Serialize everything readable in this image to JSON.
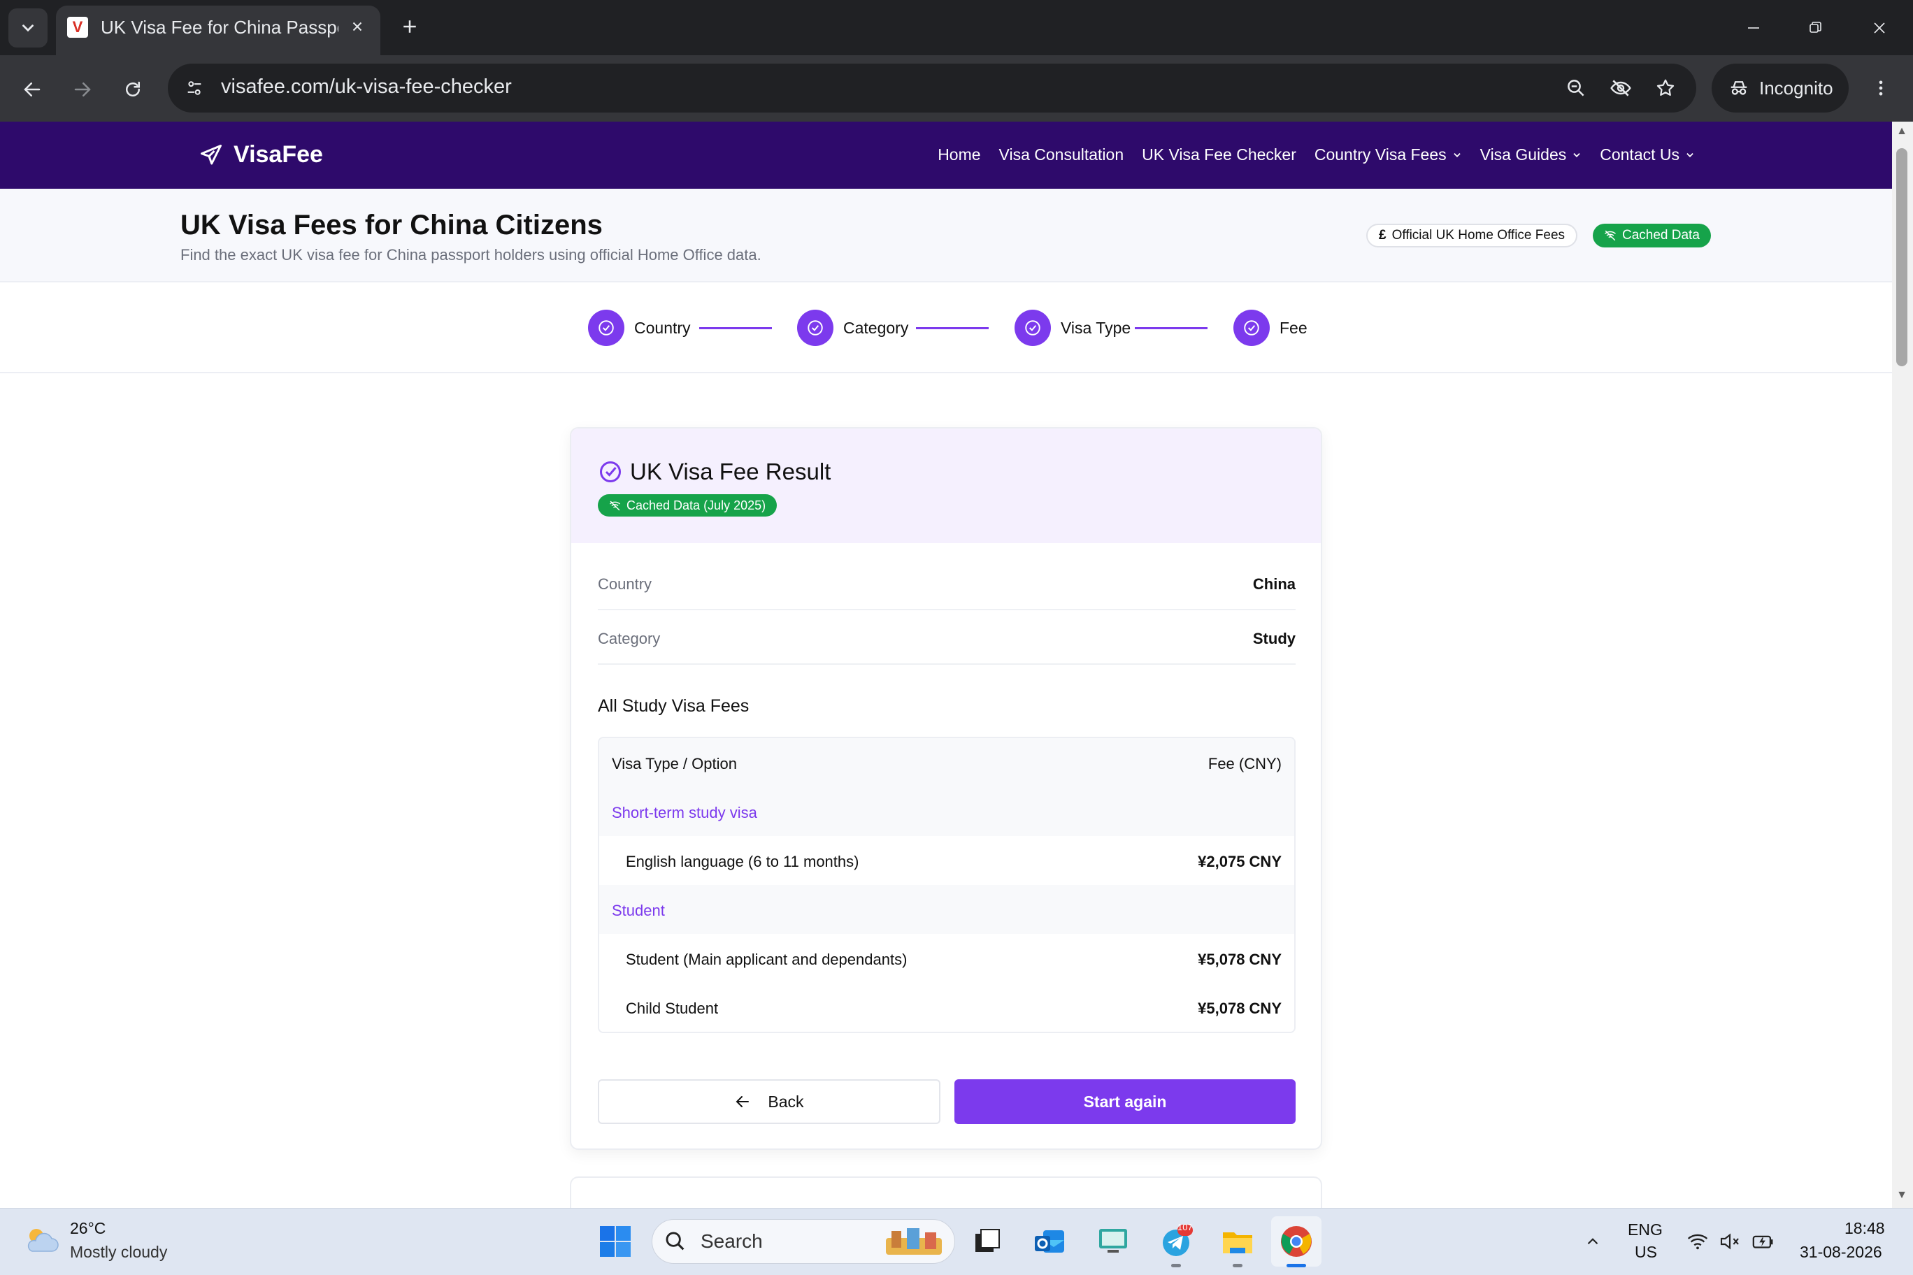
{
  "browser": {
    "tab_title": "UK Visa Fee for China Passport Holders",
    "url": "visafee.com/uk-visa-fee-checker",
    "incognito_label": "Incognito"
  },
  "site": {
    "logo": "VisaFee",
    "nav": [
      {
        "label": "Home"
      },
      {
        "label": "Visa Consultation"
      },
      {
        "label": "UK Visa Fee Checker"
      },
      {
        "label": "Country Visa Fees"
      },
      {
        "label": "Visa Guides"
      },
      {
        "label": "Contact Us"
      }
    ]
  },
  "page": {
    "title": "UK Visa Fees for China Citizens",
    "subtitle": "Find the exact UK visa fee for China passport holders using official Home Office data.",
    "badge_official": "Official UK Home Office Fees",
    "badge_cached": "Cached Data"
  },
  "stepper": [
    {
      "label": "Country"
    },
    {
      "label": "Category"
    },
    {
      "label": "Visa Type"
    },
    {
      "label": "Fee"
    }
  ],
  "result": {
    "title": "UK Visa Fee Result",
    "badge": "Cached Data (July 2025)",
    "summary": [
      {
        "label": "Country",
        "value": "China"
      },
      {
        "label": "Category",
        "value": "Study"
      }
    ],
    "fees_heading": "All Study Visa Fees",
    "table_header": {
      "left": "Visa Type / Option",
      "right": "Fee (CNY)"
    },
    "groups": [
      {
        "name": "Short-term study visa",
        "rows": [
          {
            "label": "English language (6 to 11 months)",
            "fee": "¥2,075 CNY"
          }
        ]
      },
      {
        "name": "Student",
        "rows": [
          {
            "label": "Student (Main applicant and dependants)",
            "fee": "¥5,078 CNY"
          },
          {
            "label": "Child Student",
            "fee": "¥5,078 CNY"
          }
        ]
      }
    ],
    "back_label": "Back",
    "start_label": "Start again"
  },
  "colors": {
    "header_bg": "#2e0a6b",
    "accent": "#7c3aed",
    "cached_green": "#16a34a"
  },
  "taskbar": {
    "weather_temp": "26°C",
    "weather_desc": "Mostly cloudy",
    "search_placeholder": "Search",
    "telegram_badge": "107",
    "lang_primary": "ENG",
    "lang_secondary": "US",
    "time": "18:48",
    "date": "31-08-2026"
  }
}
